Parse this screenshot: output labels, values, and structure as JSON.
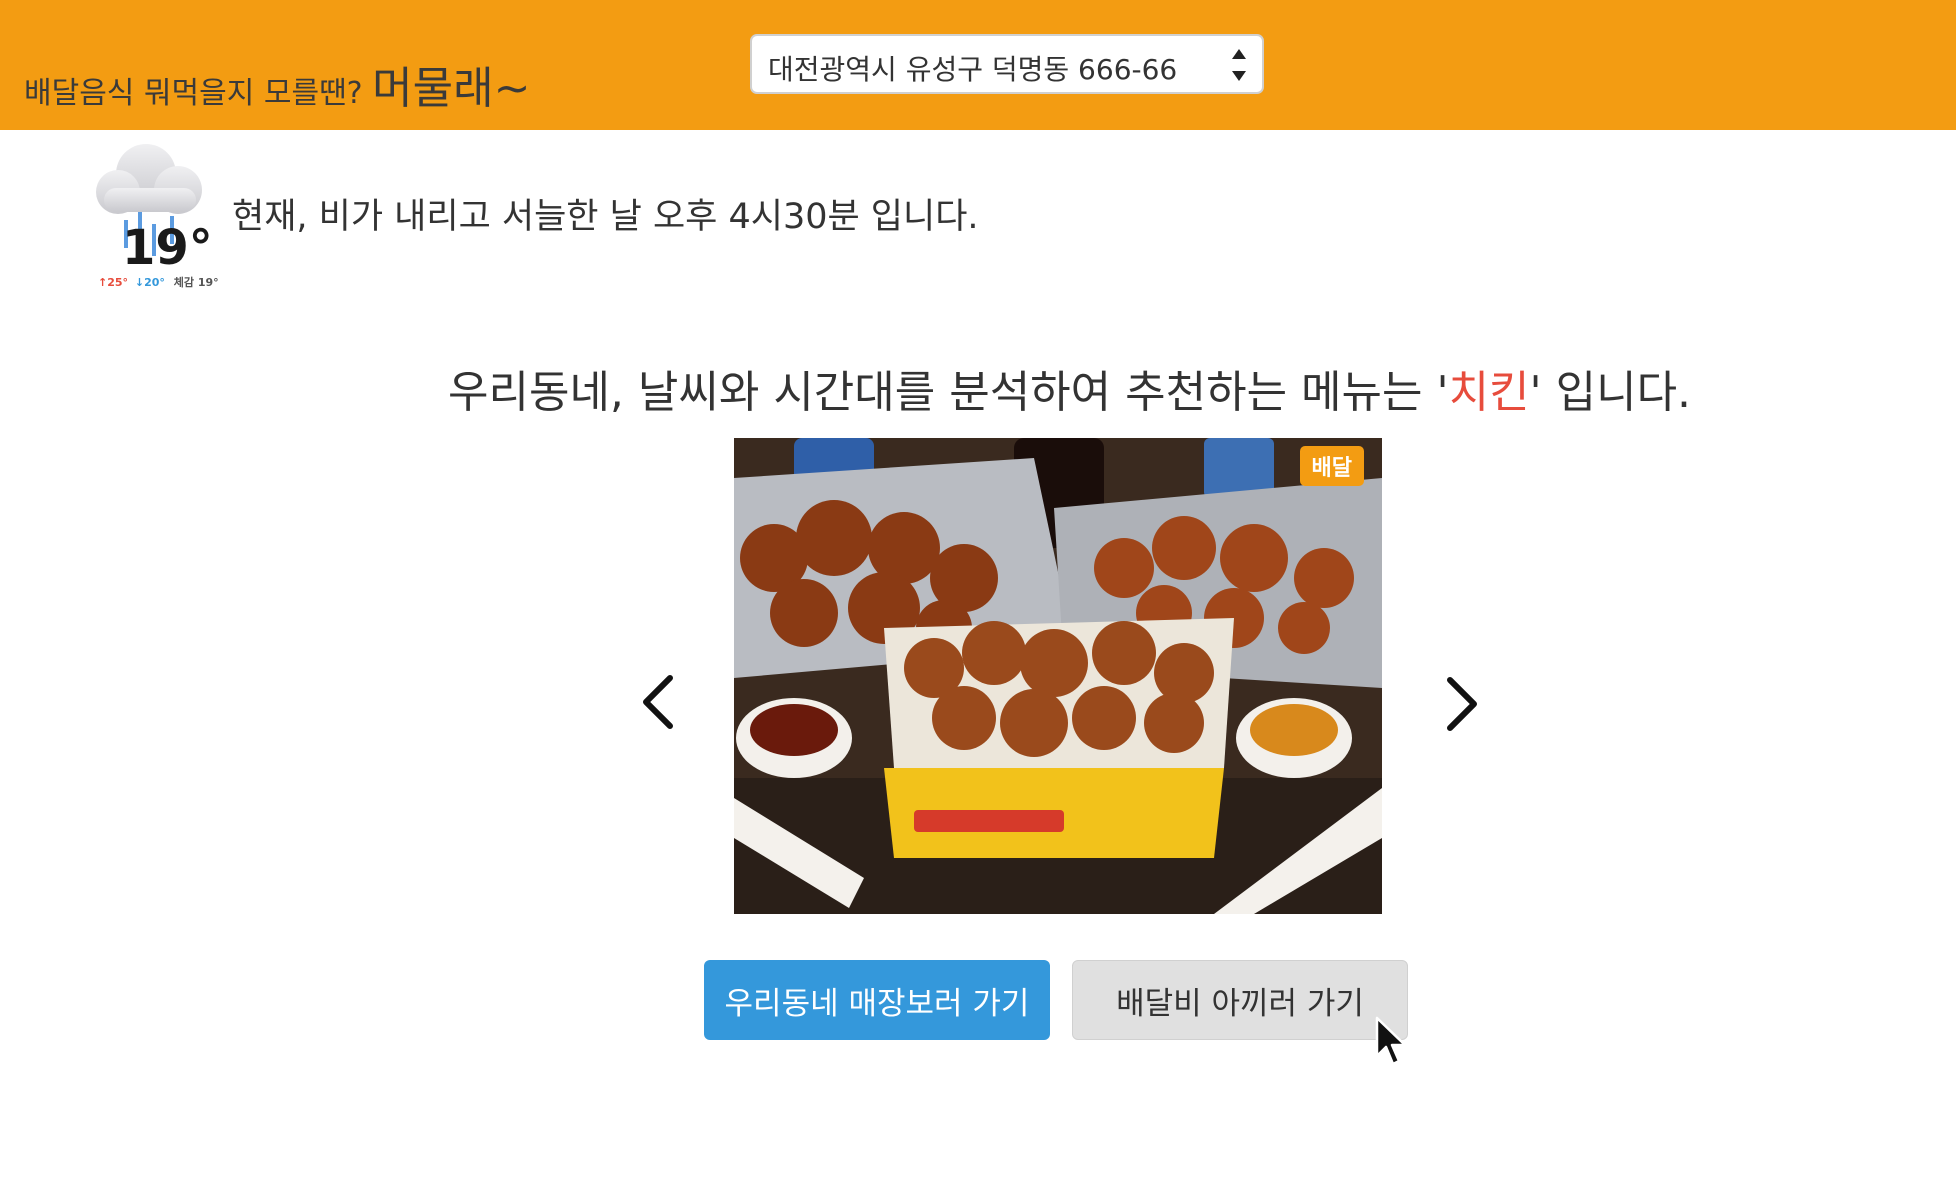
{
  "header": {
    "tagline_lead": "배달음식 뭐먹을지 모를땐? ",
    "brand": "머물래~",
    "background_color": "#f39c12",
    "address_select": {
      "value": "대전광역시 유성구 덕명동 666-66"
    }
  },
  "weather": {
    "icon": "rain-cloud-icon",
    "temperature": "19°",
    "high": "↑25°",
    "low": "↓20°",
    "feels_like": "체감 19°",
    "status_text": "현재, 비가 내리고 서늘한 날 오후 4시30분 입니다."
  },
  "recommendation": {
    "text_before": "우리동네, 날씨와 시간대를 분석하여 추천하는 메뉴는 '",
    "menu": "치킨",
    "text_after": "' 입니다.",
    "menu_color": "#e74c3c"
  },
  "carousel": {
    "badge": "배달",
    "prev_icon": "chevron-left-icon",
    "next_icon": "chevron-right-icon"
  },
  "actions": {
    "primary_label": "우리동네 매장보러 가기",
    "secondary_label": "배달비 아끼러 가기",
    "primary_color": "#3498db"
  }
}
